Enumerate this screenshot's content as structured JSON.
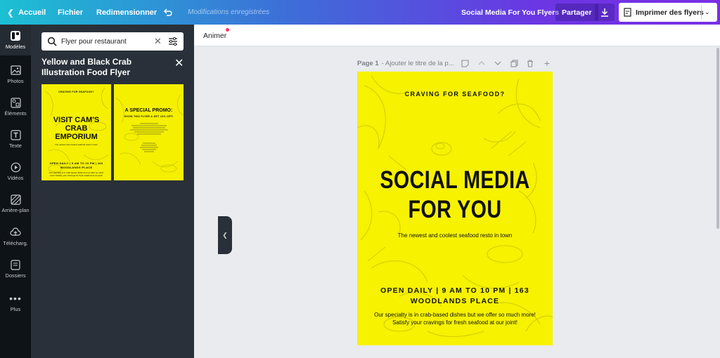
{
  "topbar": {
    "back_label": "Accueil",
    "menu": [
      "Fichier",
      "Redimensionner"
    ],
    "saved_status": "Modifications enregistrées",
    "design_title": "Social Media For You Flyers",
    "share_label": "Partager",
    "print_label": "Imprimer des flyers"
  },
  "rail": {
    "items": [
      {
        "label": "Modèles",
        "icon": "templates-icon"
      },
      {
        "label": "Photos",
        "icon": "photos-icon"
      },
      {
        "label": "Éléments",
        "icon": "elements-icon"
      },
      {
        "label": "Texte",
        "icon": "text-icon"
      },
      {
        "label": "Vidéos",
        "icon": "video-icon"
      },
      {
        "label": "Arrière-plan",
        "icon": "background-icon"
      },
      {
        "label": "Télécharg.",
        "icon": "upload-icon"
      },
      {
        "label": "Dossiers",
        "icon": "folder-icon"
      },
      {
        "label": "Plus",
        "icon": "more-icon"
      }
    ]
  },
  "panel": {
    "search_value": "Flyer pour restaurant",
    "template_title": "Yellow and Black Crab Illustration Food Flyer",
    "thumb1": {
      "top": "CRAVING FOR SEAFOOD?",
      "title": "VISIT CAM'S CRAB EMPORIUM",
      "sub": "The newest and coolest seafood resto in town",
      "open": "OPEN DAILY | 9 AM TO 10 PM | 163 WOODLANDS PLACE",
      "body": "Our specialty is in crab-based dishes but we offer so much more! Satisfy your cravings for fresh seafood at our joint!"
    },
    "thumb2": {
      "title": "A SPECIAL PROMO:",
      "sub": "SHOW THIS FLYER & GET 10% OFF!"
    }
  },
  "subbar": {
    "animate_label": "Animer"
  },
  "page": {
    "label": "Page 1",
    "title_placeholder": "- Ajouter le titre de la p..."
  },
  "flyer": {
    "top": "CRAVING FOR SEAFOOD?",
    "title": "SOCIAL MEDIA FOR YOU",
    "sub": "The newest and coolest seafood resto in town",
    "open": "OPEN DAILY | 9 AM TO 10 PM | 163 WOODLANDS PLACE",
    "body": "Our specialty is in crab-based dishes but we offer so much more! Satisfy your cravings for fresh seafood at our joint!"
  },
  "colors": {
    "flyer_bg": "#f6f200",
    "panel_bg": "#293039",
    "rail_bg": "#0e1318",
    "accent_dot": "#ff3366"
  }
}
